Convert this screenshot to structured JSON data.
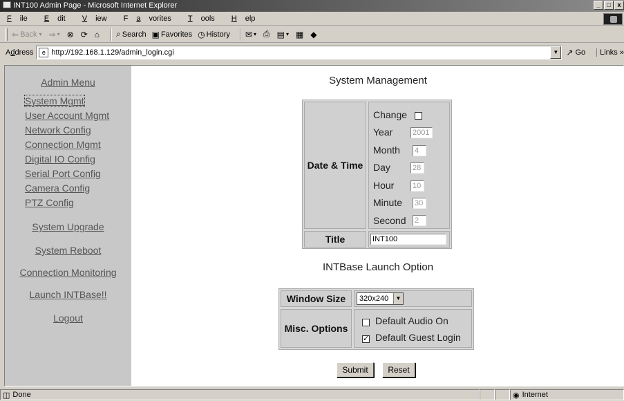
{
  "window": {
    "title": "INT100 Admin Page - Microsoft Internet Explorer",
    "controls": [
      "_",
      "□",
      "x"
    ]
  },
  "menubar": {
    "items": [
      {
        "u": "F",
        "rest": "ile"
      },
      {
        "u": "E",
        "rest": "dit"
      },
      {
        "u": "V",
        "rest": "iew"
      },
      {
        "pre": "F",
        "u": "a",
        "rest": "vorites"
      },
      {
        "u": "T",
        "rest": "ools"
      },
      {
        "u": "H",
        "rest": "elp"
      }
    ]
  },
  "toolbar": {
    "back": "Back",
    "search": "Search",
    "favorites": "Favorites",
    "history": "History"
  },
  "address": {
    "label_pre": "A",
    "label_u": "d",
    "label_rest": "dress",
    "url": "http://192.168.1.129/admin_login.cgi",
    "go": "Go",
    "links": "Links"
  },
  "sidebar": {
    "title": "Admin Menu",
    "items": [
      "System Mgmt",
      "User Account Mgmt",
      "Network Config",
      "Connection Mgmt",
      "Digital IO Config",
      "Serial Port Config",
      "Camera Config",
      "PTZ Config"
    ],
    "actions": [
      "System Upgrade",
      "System Reboot",
      "Connection Monitoring",
      "Launch INTBase!!",
      "Logout"
    ]
  },
  "system_management": {
    "heading": "System Management",
    "datetime_label": "Date & Time",
    "change_label": "Change",
    "change_checked": false,
    "year_label": "Year",
    "year_value": "2001",
    "month_label": "Month",
    "month_value": "4",
    "day_label": "Day",
    "day_value": "28",
    "hour_label": "Hour",
    "hour_value": "10",
    "minute_label": "Minute",
    "minute_value": "30",
    "second_label": "Second",
    "second_value": "2",
    "title_label": "Title",
    "title_value": "INT100"
  },
  "launch_option": {
    "heading": "INTBase Launch Option",
    "window_size_label": "Window Size",
    "window_size_value": "320x240",
    "misc_label": "Misc. Options",
    "audio_label": "Default Audio On",
    "audio_checked": false,
    "guest_label": "Default Guest Login",
    "guest_checked": true
  },
  "buttons": {
    "submit": "Submit",
    "reset": "Reset"
  },
  "statusbar": {
    "status": "Done",
    "zone": "Internet"
  }
}
